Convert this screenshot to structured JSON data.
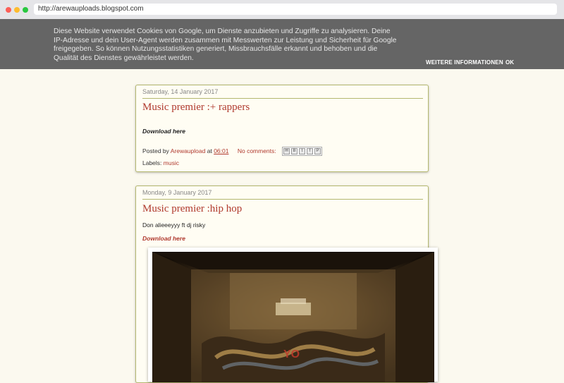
{
  "browser": {
    "url": "http://arewauploads.blogspot.com"
  },
  "cookie_banner": {
    "text": "Diese Website verwendet Cookies von Google, um Dienste anzubieten und Zugriffe zu analysieren. Deine IP-Adresse und dein User-Agent werden zusammen mit Messwerten zur Leistung und Sicherheit für Google freigegeben. So können Nutzungsstatistiken generiert, Missbrauchsfälle erkannt und behoben und die Qualität des Dienstes gewährleistet werden.",
    "more_label": "WEITERE INFORMATIONEN",
    "ok_label": "OK"
  },
  "posts": [
    {
      "date": "Saturday, 14 January 2017",
      "title": "Music premier :+ rappers",
      "download": "Download here",
      "footer": {
        "posted_by": "Posted by",
        "author": "Arewaupload",
        "at": "at",
        "time": "06:01",
        "comments": "No comments:",
        "share_icons": [
          "email-icon",
          "blog-icon",
          "twitter-icon",
          "facebook-icon",
          "pinterest-icon"
        ]
      },
      "labels_prefix": "Labels:",
      "label": "music"
    },
    {
      "date": "Monday, 9 January 2017",
      "title": "Music premier :hip hop",
      "body": "Don alieeeyyy ft dj risky",
      "download": "Download here"
    }
  ],
  "colors": {
    "link": "#b03a2e",
    "border": "#b4b870",
    "banner": "#656565"
  }
}
